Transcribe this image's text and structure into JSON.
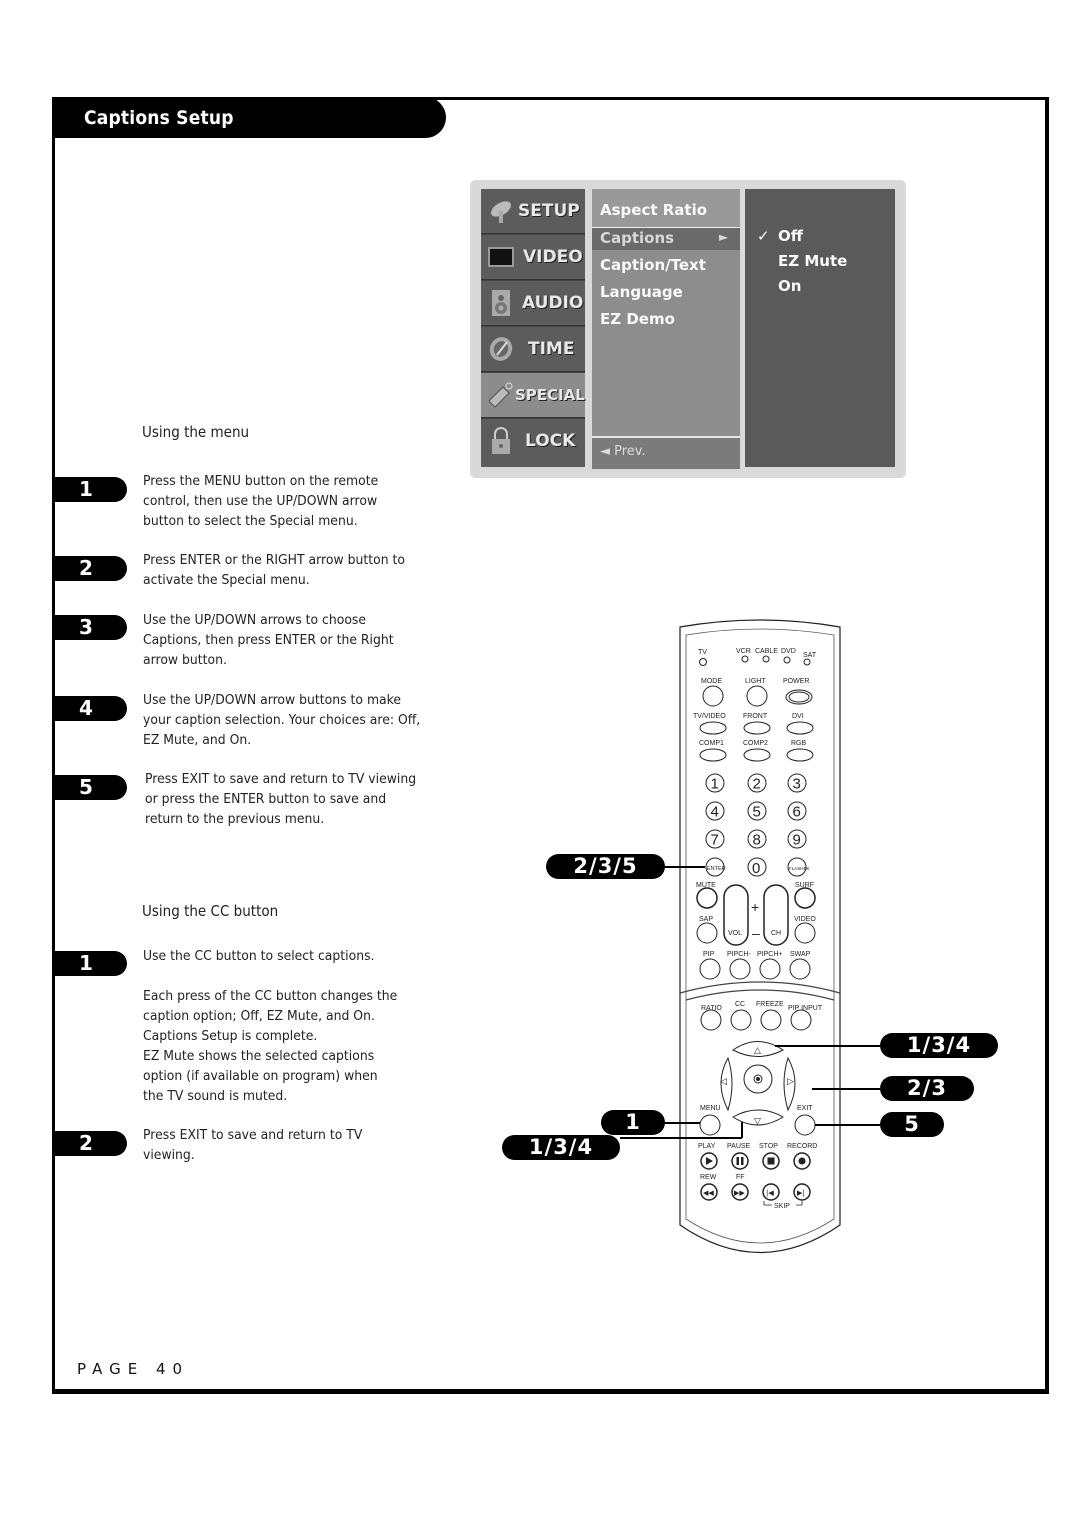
{
  "header": {
    "title": "Captions Setup"
  },
  "section_menu": {
    "heading": "Using the menu",
    "steps": [
      {
        "num": "1",
        "text": "Press the MENU button on the remote control, then use the UP/DOWN arrow button to select the Special menu."
      },
      {
        "num": "2",
        "text": "Press ENTER or the RIGHT arrow button to activate the Special menu."
      },
      {
        "num": "3",
        "text": "Use the UP/DOWN arrows to choose Captions, then press ENTER or the Right arrow button."
      },
      {
        "num": "4",
        "text": "Use the UP/DOWN arrow buttons to make your caption selection. Your choices are: Off, EZ Mute, and On."
      },
      {
        "num": "5",
        "text": "Press EXIT to save and return to TV viewing or press the ENTER button to save and return to the previous menu."
      }
    ]
  },
  "section_cc": {
    "heading": "Using the CC button",
    "steps": [
      {
        "num": "1",
        "text": "Use the CC button to select captions."
      },
      {
        "num": "2",
        "text": "Press EXIT to save and return to TV viewing."
      }
    ],
    "note_lines": [
      "Each press of the CC button changes the",
      "caption option; Off, EZ Mute, and On.",
      "Captions Setup is complete.",
      "EZ Mute shows the selected captions",
      "option (if available on program) when",
      "the TV sound is muted."
    ]
  },
  "osd_menu": {
    "main_items": [
      {
        "label": "SETUP",
        "icon": "satellite-dish-icon"
      },
      {
        "label": "VIDEO",
        "icon": "tv-screen-icon"
      },
      {
        "label": "AUDIO",
        "icon": "speaker-icon"
      },
      {
        "label": "TIME",
        "icon": "clock-icon"
      },
      {
        "label": "SPECIAL",
        "icon": "tag-icon",
        "active": true
      },
      {
        "label": "LOCK",
        "icon": "padlock-icon"
      }
    ],
    "sub_items": [
      "Aspect Ratio",
      "Captions",
      "Caption/Text",
      "Language",
      "EZ Demo"
    ],
    "sub_selected": "Captions",
    "submenu_arrow": "►",
    "prev_label": "◄ Prev.",
    "options": [
      "Off",
      "EZ Mute",
      "On"
    ],
    "option_checked": "Off",
    "check_glyph": "✓"
  },
  "callouts": {
    "enter": "2/3/5",
    "menu": "1",
    "down": "1/3/4",
    "up": "1/3/4",
    "right": "2/3",
    "exit": "5"
  },
  "remote": {
    "mode_leds": [
      "TV",
      "VCR",
      "CABLE",
      "DVD",
      "SAT"
    ],
    "row1": [
      "MODE",
      "LIGHT",
      "POWER"
    ],
    "row2": [
      "TV/VIDEO",
      "FRONT",
      "DVI"
    ],
    "row3": [
      "COMP1",
      "COMP2",
      "RGB"
    ],
    "digits": [
      "1",
      "2",
      "3",
      "4",
      "5",
      "6",
      "7",
      "8",
      "9"
    ],
    "bottom_digits": [
      "ENTER",
      "0",
      "FLASHBK"
    ],
    "side_labels": [
      "MUTE",
      "SURF",
      "SAP",
      "VIDEO"
    ],
    "rocker_labels": [
      "VOL",
      "CH"
    ],
    "pip_row": [
      "PIP",
      "PIPCH-",
      "PIPCH+",
      "SWAP"
    ],
    "func_row": [
      "RATIO",
      "CC",
      "FREEZE",
      "PIP INPUT"
    ],
    "nav_labels": [
      "MENU",
      "EXIT"
    ],
    "transport_row1": [
      "PLAY",
      "PAUSE",
      "STOP",
      "RECORD"
    ],
    "transport_row2": [
      "REW",
      "FF"
    ],
    "skip_label": "SKIP"
  },
  "footer": {
    "page_label": "PAGE 40"
  }
}
